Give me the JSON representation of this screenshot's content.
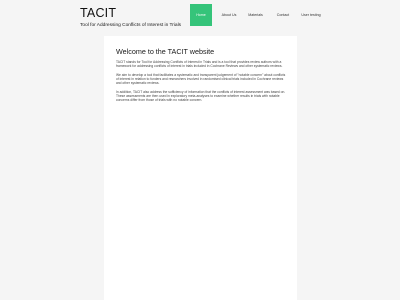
{
  "header": {
    "title": "TACIT",
    "subtitle": "Tool for Addressing Conflicts of Interest in Trials"
  },
  "nav": {
    "items": [
      {
        "label": "Home",
        "active": true
      },
      {
        "label": "About Us",
        "active": false
      },
      {
        "label": "Materials",
        "active": false
      },
      {
        "label": "Contact",
        "active": false
      },
      {
        "label": "User testing",
        "active": false
      }
    ]
  },
  "colors": {
    "accent": "#35c47a",
    "page_background": "#f5f5f5",
    "content_background": "#ffffff"
  },
  "main": {
    "title": "Welcome to the TACIT website",
    "paragraphs": [
      "TACIT stands for Tool for Addressing Conflicts of Interest in Trials and is a tool that provides review authors with a framework for addressing conflicts of interest in trials included in Cochrane Reviews and other systematic reviews.",
      "We aim to develop a tool that facilitates a systematic and transparent judgement of \"notable concern\" about conflicts of interest in relation to funders and researchers involved in randomised clinical trials included in Cochrane reviews and other systematic reviews.",
      "In addition, TACIT also address the sufficiency of information that the conflicts of interest assessment was based on. These assessments are then used in exploratory meta-analyses to examine whether results in trials with notable concerns differ from those of trials with no notable concern."
    ]
  }
}
